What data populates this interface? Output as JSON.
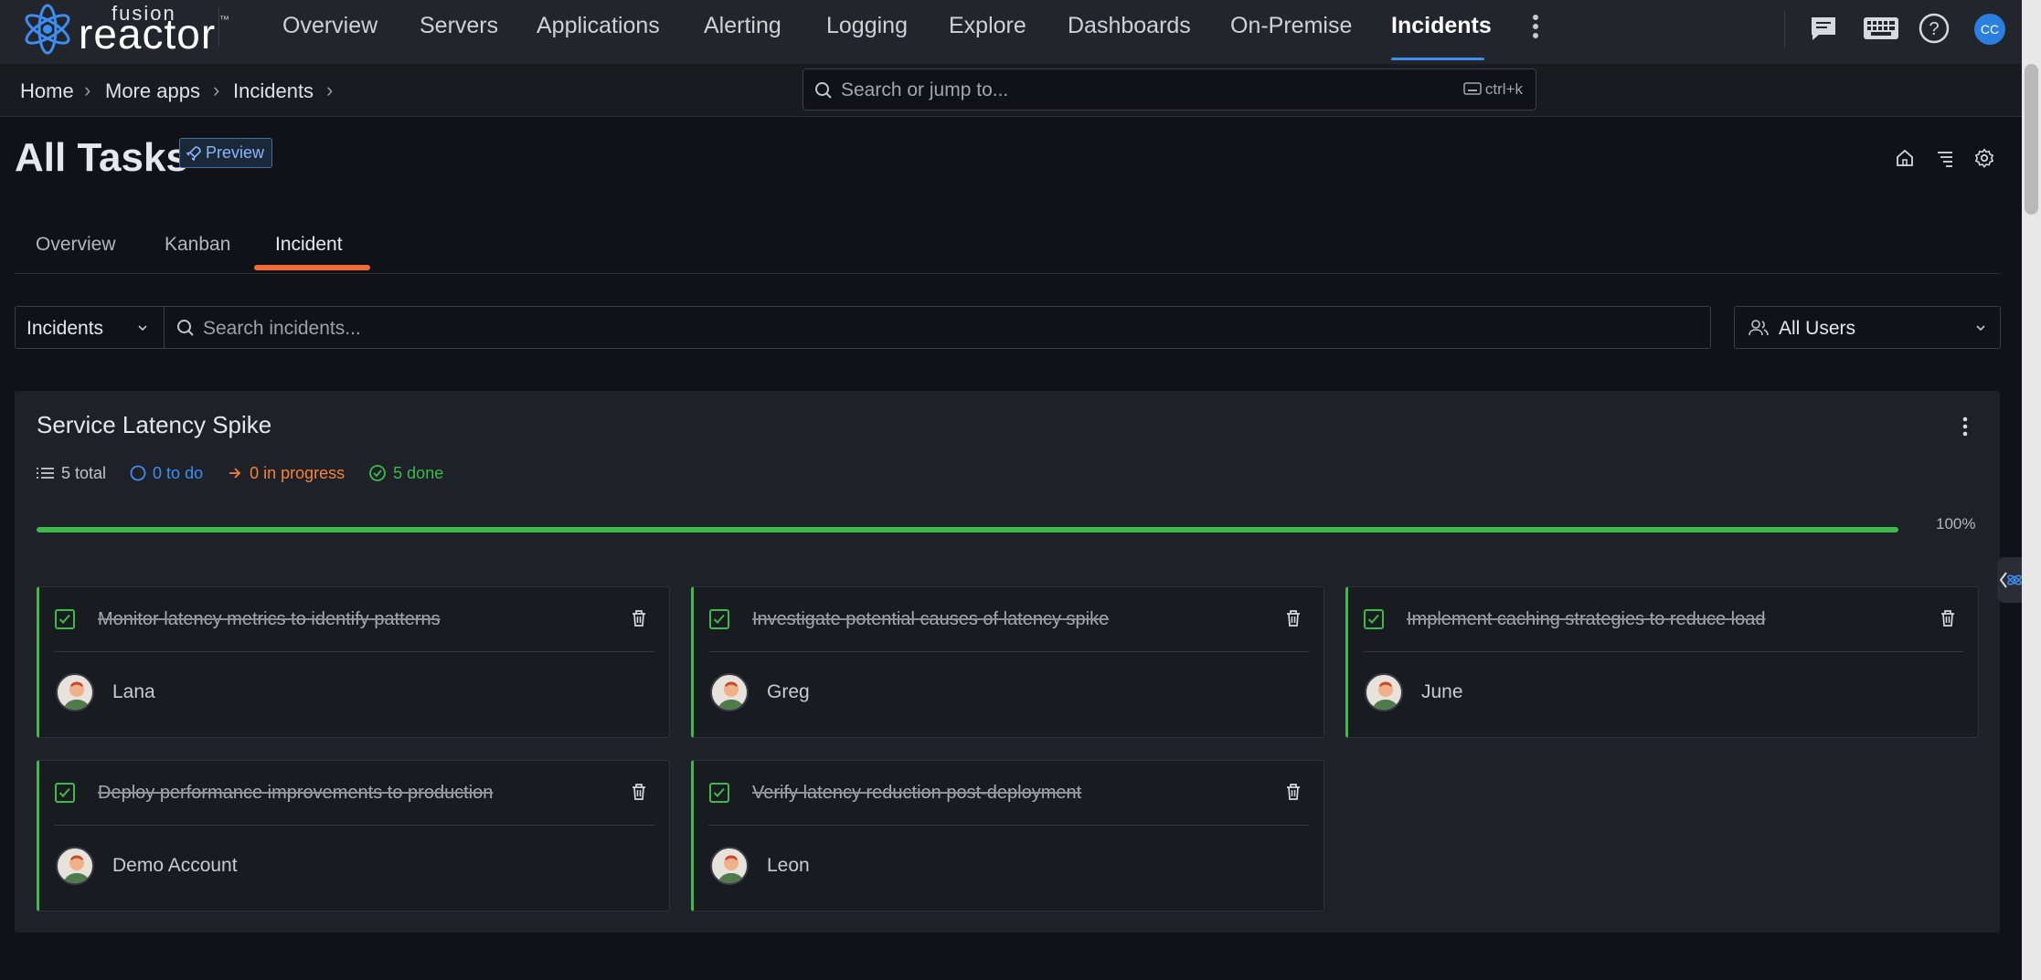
{
  "brand": {
    "fusion": "fusion",
    "reactor": "reactor",
    "tm": "™"
  },
  "nav": {
    "items": [
      "Overview",
      "Servers",
      "Applications",
      "Alerting",
      "Logging",
      "Explore",
      "Dashboards",
      "On-Premise",
      "Incidents"
    ],
    "active": "Incidents",
    "avatar_initials": "CC"
  },
  "breadcrumb": [
    "Home",
    "More apps",
    "Incidents"
  ],
  "global_search": {
    "placeholder": "Search or jump to...",
    "shortcut": "ctrl+k"
  },
  "page": {
    "title": "All Tasks",
    "badge": "Preview"
  },
  "tabs": [
    "Overview",
    "Kanban",
    "Incident"
  ],
  "filters": {
    "type_select": "Incidents",
    "search_placeholder": "Search incidents...",
    "users_select": "All Users"
  },
  "incident": {
    "title": "Service Latency Spike",
    "stats": {
      "total": "5 total",
      "todo": "0 to do",
      "in_progress": "0 in progress",
      "done": "5 done"
    },
    "progress_percent": 100,
    "progress_label": "100%",
    "tasks": [
      {
        "title": "Monitor latency metrics to identify patterns",
        "assignee": "Lana",
        "done": true
      },
      {
        "title": "Investigate potential causes of latency spike",
        "assignee": "Greg",
        "done": true
      },
      {
        "title": "Implement caching strategies to reduce load",
        "assignee": "June",
        "done": true
      },
      {
        "title": "Deploy performance improvements to production",
        "assignee": "Demo Account",
        "done": true
      },
      {
        "title": "Verify latency reduction post-deployment",
        "assignee": "Leon",
        "done": true
      }
    ]
  },
  "colors": {
    "accent_blue": "#3d8ef0",
    "tab_orange": "#f06a3a",
    "done_green": "#3cba4a",
    "todo_blue": "#3d8ef0",
    "progress_orange": "#f5823a"
  }
}
